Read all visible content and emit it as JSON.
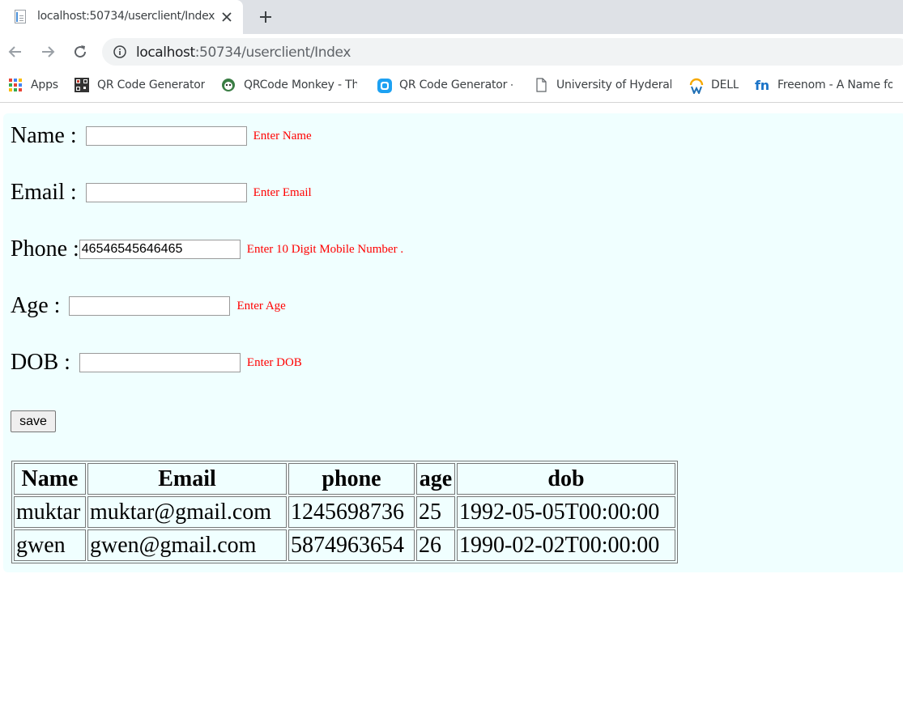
{
  "browser": {
    "tab_title": "localhost:50734/userclient/Index",
    "url_host": "localhost",
    "url_rest": ":50734/userclient/Index",
    "bookmarks": [
      {
        "label": "Apps",
        "icon": "apps-grid-icon"
      },
      {
        "label": "QR Code Generator",
        "icon": "qr-code-icon"
      },
      {
        "label": "QRCode Monkey - Th",
        "icon": "qrcode-monkey-icon"
      },
      {
        "label": "QR Code Generator -",
        "icon": "qr-generator-icon"
      },
      {
        "label": "University of Hyderab",
        "icon": "page-icon"
      },
      {
        "label": "DELL",
        "icon": "dell-icon"
      },
      {
        "label": "Freenom - A Name fo",
        "icon": "freenom-icon"
      }
    ]
  },
  "form": {
    "name_label": "Name : ",
    "name_value": "",
    "name_error": "Enter Name",
    "email_label": "Email : ",
    "email_value": "",
    "email_error": "Enter Email",
    "phone_label": "Phone :",
    "phone_value": "46546545646465",
    "phone_error": "Enter 10 Digit Mobile Number .",
    "age_label": "Age : ",
    "age_value": "",
    "age_error": "Enter Age",
    "dob_label": "DOB : ",
    "dob_value": "",
    "dob_error": "Enter DOB",
    "save_label": "save"
  },
  "table": {
    "headers": [
      "Name",
      "Email",
      "phone",
      "age",
      "dob"
    ],
    "rows": [
      [
        "muktar",
        "muktar@gmail.com",
        "1245698736",
        "25",
        "1992-05-05T00:00:00"
      ],
      [
        "gwen",
        "gwen@gmail.com",
        "5874963654",
        "26",
        "1990-02-02T00:00:00"
      ]
    ]
  },
  "colors": {
    "page_background": "#f0ffff",
    "error_text": "#ff0000"
  }
}
